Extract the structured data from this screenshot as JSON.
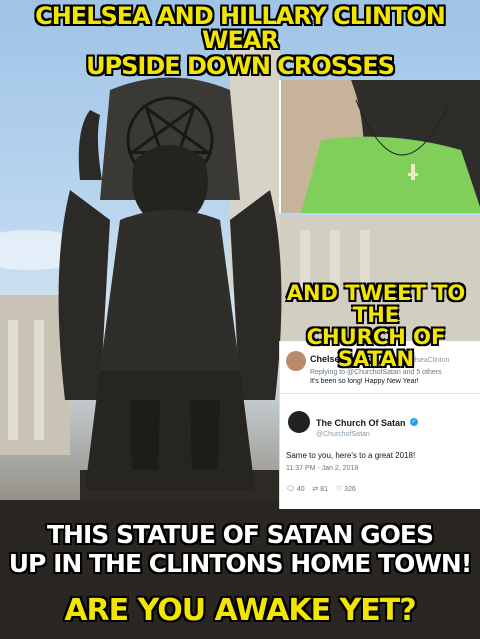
{
  "captions": {
    "top_line1": "CHELSEA AND HILLARY CLINTON WEAR",
    "top_line2": "UPSIDE  DOWN CROSSES",
    "mid_line1": "AND TWEET TO THE",
    "mid_line2": "CHURCH OF SATAN",
    "bottom_line1": "THIS STATUE OF SATAN  GOES",
    "bottom_line2": "UP IN THE CLINTONS HOME TOWN!",
    "bottom_line3": "ARE YOU AWAKE YET?"
  },
  "tweet1": {
    "name": "Chelsea Clinton",
    "handle": "@ChelseaClinton",
    "replying": "Replying to @ChurchofSatan and 5 others",
    "text": "It's been so long! Happy New Year!"
  },
  "tweet2": {
    "name": "The Church Of Satan",
    "handle": "@ChurchofSatan",
    "text": "Same to you, here's to a great 2018!",
    "timestamp": "11:37 PM - Jan 2, 2018",
    "replies": "40",
    "retweets": "81",
    "likes": "326"
  },
  "colors": {
    "caption_yellow": "#f2e600",
    "caption_white": "#ffffff",
    "twitter_blue": "#1da1f2"
  },
  "icons": [
    "verified-badge-icon",
    "reply-icon",
    "retweet-icon",
    "like-icon",
    "pentagram-icon",
    "cross-pendant-icon"
  ]
}
